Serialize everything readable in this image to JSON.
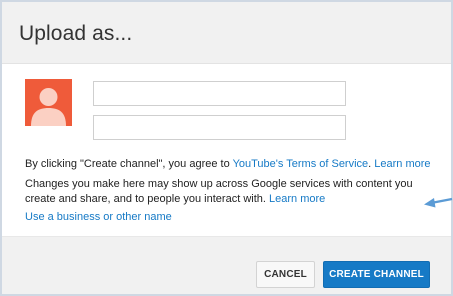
{
  "dialog": {
    "title": "Upload as..."
  },
  "form": {
    "first_name_value": "",
    "last_name_value": ""
  },
  "terms": {
    "prefix": "By clicking \"Create channel\", you agree to ",
    "tos_link": "YouTube's Terms of Service",
    "learn_more": "Learn more"
  },
  "notice": {
    "line1": "Changes you make here may show up across Google services with content you",
    "line2": "create and share, and to people you interact with. ",
    "learn_more": "Learn more"
  },
  "business_link": "Use a business or other name",
  "buttons": {
    "cancel": "CANCEL",
    "create": "CREATE CHANNEL"
  },
  "colors": {
    "accent": "#167ac6",
    "avatar_bg": "#ef5b3a",
    "annotation_arrow": "#5b9bd5"
  },
  "icons": {
    "avatar": "person-silhouette",
    "annotation": "arrow-left"
  }
}
